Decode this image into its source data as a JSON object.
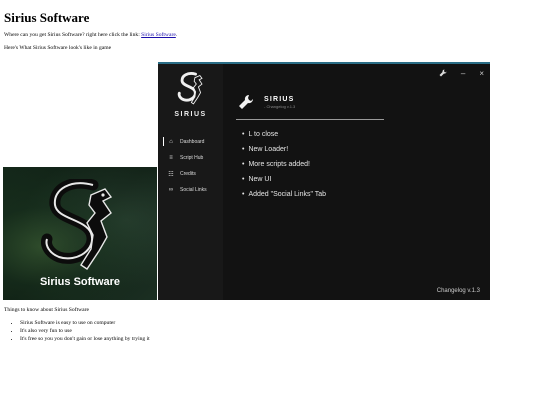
{
  "page": {
    "title": "Sirius Software",
    "intro_text": "Where can you get Sirius Software? right here click the link: ",
    "link_text": "Sirius Software",
    "intro_end": ".",
    "looks_text": "Here's What Sirius Software look's like in game",
    "things_heading": "Things to know about Sirius Software",
    "bullets": [
      "Sirius Software is easy to use on computer",
      "It's also very fun to use",
      "It's free so you you don't gain or lose anything by trying it"
    ]
  },
  "promo": {
    "title": "Sirius Software",
    "icon": "sirius-logo-icon"
  },
  "app": {
    "brand": "SIRIUS",
    "nav": [
      {
        "label": "Dashboard",
        "icon": "home-icon"
      },
      {
        "label": "Script Hub",
        "icon": "list-icon"
      },
      {
        "label": "Credits",
        "icon": "people-icon"
      },
      {
        "label": "Social Links",
        "icon": "link-icon"
      }
    ],
    "window_controls": {
      "tool": "wrench-icon",
      "minimize": "–",
      "close": "×"
    },
    "header": {
      "title": "SIRIUS",
      "subtitle": "- Changelog v.1.3"
    },
    "changelog": [
      "L to close",
      "New Loader!",
      "More scripts added!",
      "New UI",
      "Added \"Social Links\" Tab"
    ],
    "version": "Changelog v.1.3",
    "accent": "#2a6d86"
  }
}
